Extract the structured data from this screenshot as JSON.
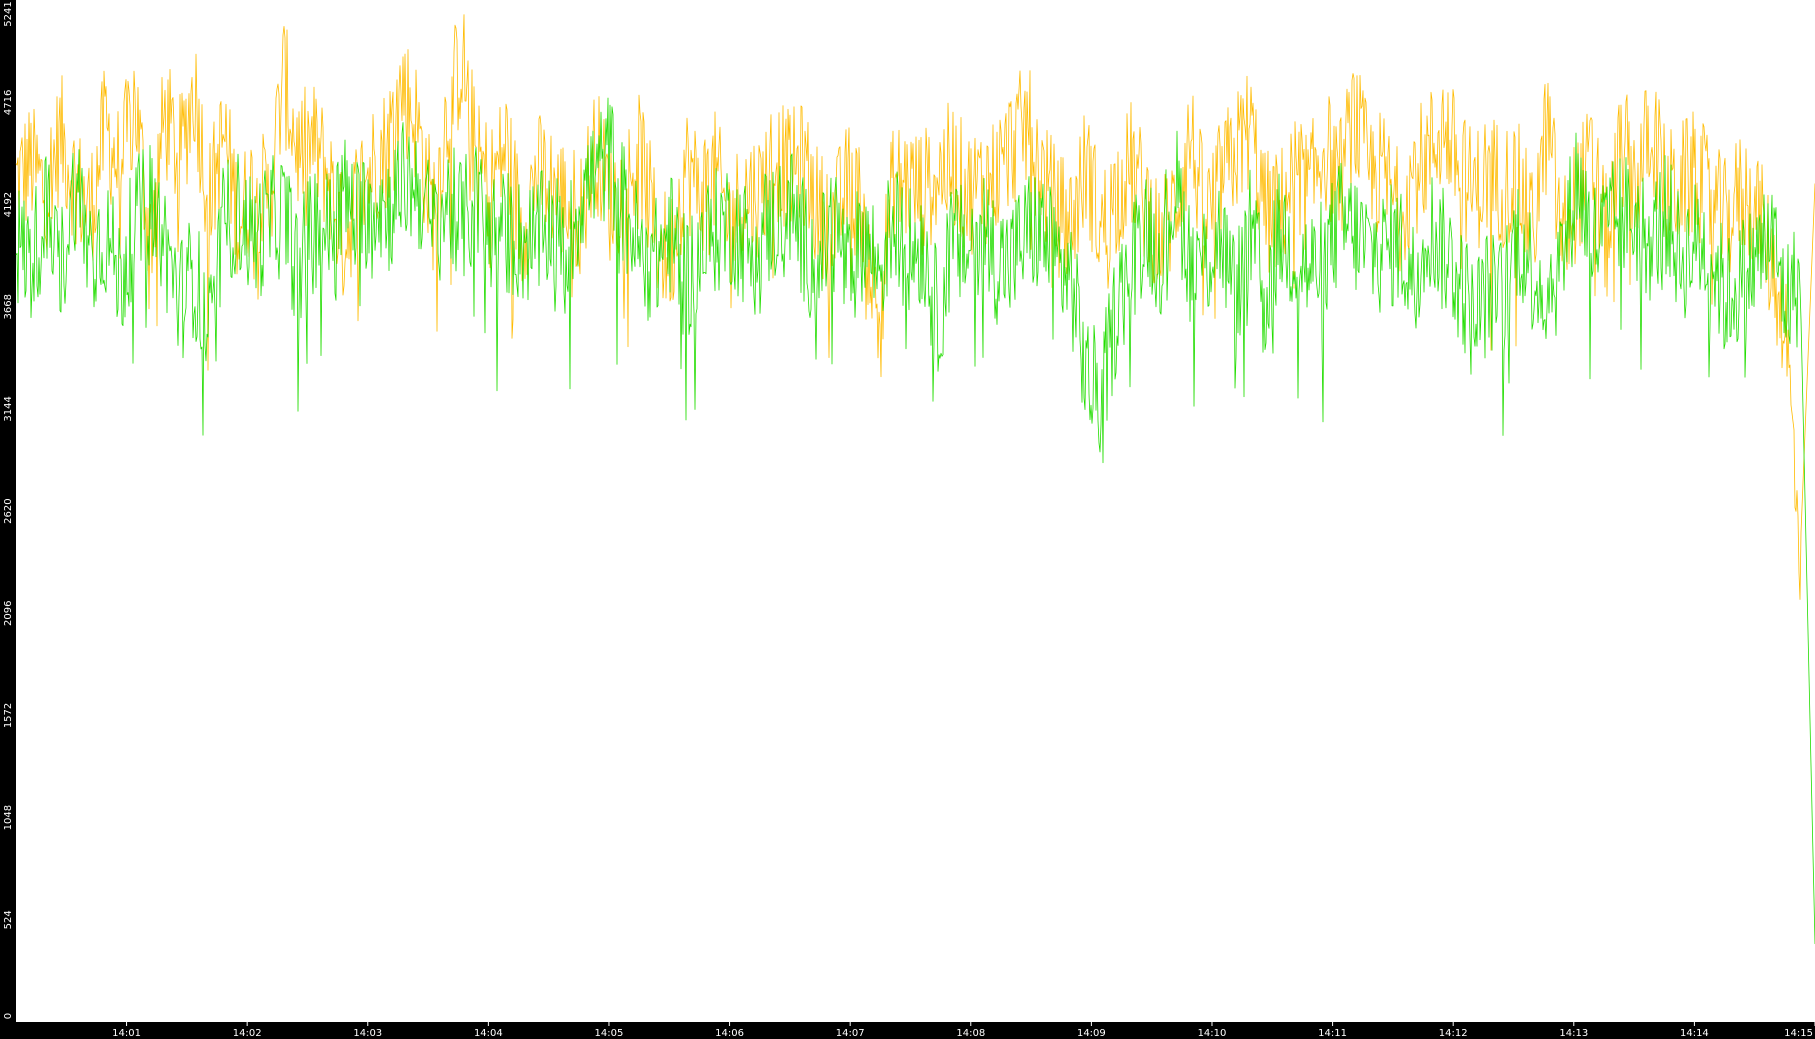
{
  "colors": {
    "background": "#000000",
    "plot_background": "#ffffff",
    "axis_text": "#ffffff"
  },
  "chart_data": {
    "type": "line",
    "title": "",
    "xlabel": "",
    "ylabel": "",
    "ylim": [
      0,
      5241
    ],
    "y_ticks": [
      "0",
      "524",
      "1048",
      "1572",
      "2096",
      "2620",
      "3144",
      "3668",
      "4192",
      "4716",
      "5241"
    ],
    "x_ticks": [
      "14:01",
      "14:02",
      "14:03",
      "14:04",
      "14:05",
      "14:06",
      "14:07",
      "14:08",
      "14:09",
      "14:10",
      "14:11",
      "14:12",
      "14:13",
      "14:14",
      "14:15"
    ],
    "x_range": [
      "14:00:05",
      "14:15:00"
    ],
    "grid": false,
    "legend": "none",
    "series": [
      {
        "color": "#ffbb00",
        "values": [
          4300,
          4400,
          4250,
          4550,
          4300,
          4150,
          4600,
          4350,
          4750,
          4000,
          4650,
          4420,
          4800,
          4200,
          4550,
          4100,
          4300,
          4200,
          4850,
          4450,
          4500,
          4350,
          4000,
          4250,
          4400,
          4500,
          4800,
          4600,
          4150,
          4650,
          4950,
          4400,
          4300,
          4500,
          4050,
          4350,
          4300,
          4200,
          4150,
          4500,
          4200,
          4300,
          4450,
          4050,
          3900,
          4400,
          4250,
          4350,
          4100,
          4250,
          4250,
          4450,
          4350,
          4400,
          4150,
          4100,
          4300,
          4150,
          3600,
          4300,
          4300,
          4250,
          4350,
          4400,
          4250,
          4300,
          4350,
          4500,
          4600,
          4350,
          4150,
          4100,
          4400,
          4050,
          4250,
          4400,
          4200,
          4000,
          4200,
          4550,
          4100,
          4300,
          4450,
          4600,
          4150,
          4150,
          4350,
          4250,
          4500,
          4300,
          4650,
          4350,
          4350,
          4150,
          4350,
          4450,
          4600,
          4400,
          4250,
          4350,
          4300,
          4300,
          4050,
          4600,
          4000,
          4250,
          4400,
          4000,
          4500,
          4300,
          4600,
          4250,
          4300,
          4350,
          4200,
          4100,
          4250,
          4200,
          3900,
          3600,
          2400,
          4300
        ]
      },
      {
        "color": "#22dd00",
        "values": [
          4000,
          3900,
          4150,
          3850,
          4300,
          3950,
          4050,
          3800,
          4100,
          4200,
          4000,
          3700,
          3850,
          3500,
          4100,
          4150,
          4000,
          4100,
          4150,
          3850,
          4100,
          4050,
          4250,
          4100,
          4250,
          4150,
          4300,
          4300,
          4050,
          4200,
          4100,
          4200,
          4050,
          4050,
          4000,
          4000,
          4100,
          3900,
          4250,
          4350,
          4450,
          4150,
          3950,
          3900,
          4050,
          3800,
          3950,
          4050,
          4100,
          4000,
          4050,
          4100,
          4200,
          4000,
          3850,
          4150,
          3800,
          4050,
          3850,
          4100,
          3950,
          4000,
          3600,
          4000,
          3950,
          4100,
          3900,
          3900,
          4050,
          4050,
          3900,
          3800,
          3300,
          3200,
          3650,
          3900,
          4100,
          3950,
          4300,
          3900,
          3900,
          4050,
          3700,
          4050,
          3700,
          4050,
          3950,
          3850,
          3900,
          4100,
          4050,
          3950,
          3950,
          4000,
          3800,
          4100,
          3950,
          3850,
          3600,
          3750,
          3700,
          4050,
          3850,
          3750,
          3900,
          4350,
          4000,
          4050,
          4150,
          4100,
          4000,
          4150,
          3900,
          4000,
          3950,
          3700,
          3800,
          3900,
          4050,
          3700,
          3800,
          400
        ]
      }
    ]
  }
}
